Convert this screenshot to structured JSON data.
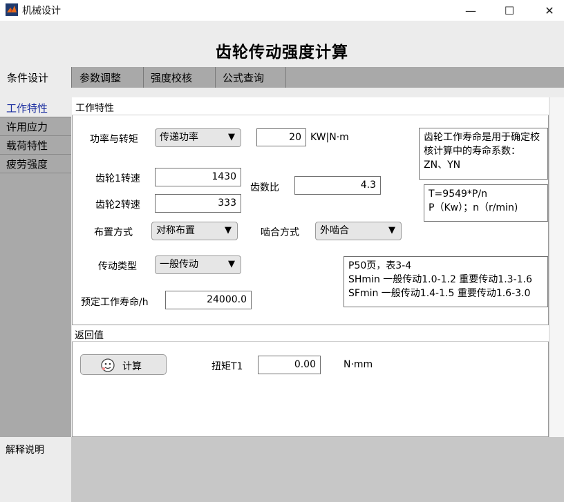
{
  "window": {
    "title": "机械设计",
    "minimize": "—",
    "maximize": "☐",
    "close": "✕"
  },
  "header": {
    "title": "齿轮传动强度计算"
  },
  "tabs": [
    {
      "label": "条件设计"
    },
    {
      "label": "参数调整"
    },
    {
      "label": "强度校核"
    },
    {
      "label": "公式查询"
    }
  ],
  "nav": [
    {
      "label": "工作特性"
    },
    {
      "label": "许用应力"
    },
    {
      "label": "载荷特性"
    },
    {
      "label": "疲劳强度"
    }
  ],
  "work": {
    "panel_title": "工作特性",
    "power_label": "功率与转矩",
    "power_mode": "传递功率",
    "power_value": "20",
    "power_unit": "KW|N·m",
    "life_note": "齿轮工作寿命是用于确定校核计算中的寿命系数：ZN、YN",
    "gear1_label": "齿轮1转速",
    "gear1_value": "1430",
    "gear2_label": "齿轮2转速",
    "gear2_value": "333",
    "ratio_label": "齿数比",
    "ratio_value": "4.3",
    "formula_line1": "T=9549*P/n",
    "formula_line2": "P（Kw）；n（r/min)",
    "layout_label": "布置方式",
    "layout_value": "对称布置",
    "mesh_label": "啮合方式",
    "mesh_value": "外啮合",
    "drive_label": "传动类型",
    "drive_value": "一般传动",
    "life_label": "预定工作寿命/h",
    "life_value": "24000.0",
    "ref_line1": "P50页，表3-4",
    "ref_line2": "SHmin 一般传动1.0-1.2 重要传动1.3-1.6",
    "ref_line3": "SFmin 一般传动1.4-1.5 重要传动1.6-3.0"
  },
  "result": {
    "panel_title": "返回值",
    "calc_label": "计算",
    "torque_label": "扭矩T1",
    "torque_value": "0.00",
    "torque_unit": "N·mm"
  },
  "explain": {
    "label": "解释说明"
  },
  "icons": {
    "app": "matlab-icon",
    "calc": "robot-face-icon",
    "dropdown": "triangle-down-icon"
  }
}
